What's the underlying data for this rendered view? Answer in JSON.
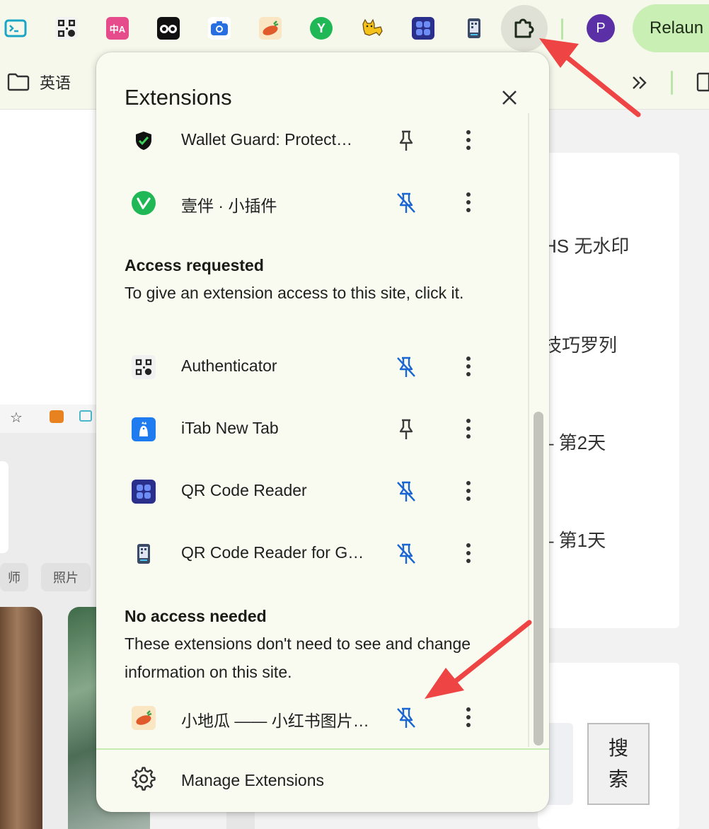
{
  "toolbar": {
    "extension_icons": [
      {
        "name": "terminal-icon"
      },
      {
        "name": "qr-code-icon"
      },
      {
        "name": "translate-icon",
        "label": "中A"
      },
      {
        "name": "owl-icon"
      },
      {
        "name": "camera-icon"
      },
      {
        "name": "sweet-potato-icon"
      },
      {
        "name": "y-logo-icon",
        "label": "Y"
      },
      {
        "name": "cat-icon"
      },
      {
        "name": "qr-reader-icon"
      },
      {
        "name": "qr-reader-g-icon"
      }
    ],
    "extensions_button_icon": "puzzle-icon",
    "profile_initial": "P",
    "relaunch_label": "Relaun"
  },
  "bookmarks": {
    "folder_label": "英语",
    "more_label": "»"
  },
  "background_page": {
    "right_texts": [
      "HS 无水印",
      "技巧罗列",
      "– 第2天",
      "– 第1天"
    ],
    "search_button_label": "搜\n索",
    "chips": [
      "师",
      "照片"
    ]
  },
  "popup": {
    "title": "Extensions",
    "pinned_items": [
      {
        "name": "Wallet Guard: Protect…",
        "icon": "shield-check-icon",
        "pinned": true
      },
      {
        "name": "壹伴 · 小插件",
        "icon": "y-logo-icon",
        "pinned": false
      }
    ],
    "access_requested": {
      "heading": "Access requested",
      "description": "To give an extension access to this site, click it.",
      "items": [
        {
          "name": "Authenticator",
          "icon": "qr-code-icon",
          "pinned": false
        },
        {
          "name": "iTab New Tab",
          "icon": "bird-icon",
          "pinned": true
        },
        {
          "name": "QR Code Reader",
          "icon": "qr-reader-icon",
          "pinned": false
        },
        {
          "name": "QR Code Reader for G…",
          "icon": "qr-reader-g-icon",
          "pinned": false
        }
      ]
    },
    "no_access": {
      "heading": "No access needed",
      "description": "These extensions don't need to see and change information on this site.",
      "items": [
        {
          "name": "小地瓜 —— 小红书图片…",
          "icon": "sweet-potato-icon",
          "pinned": false
        }
      ]
    },
    "manage_label": "Manage Extensions"
  },
  "colors": {
    "pinned": "#3c3c3c",
    "unpinned": "#1a66d2",
    "annotation_arrow": "#ee4444",
    "popup_bg": "#f9faf0"
  }
}
